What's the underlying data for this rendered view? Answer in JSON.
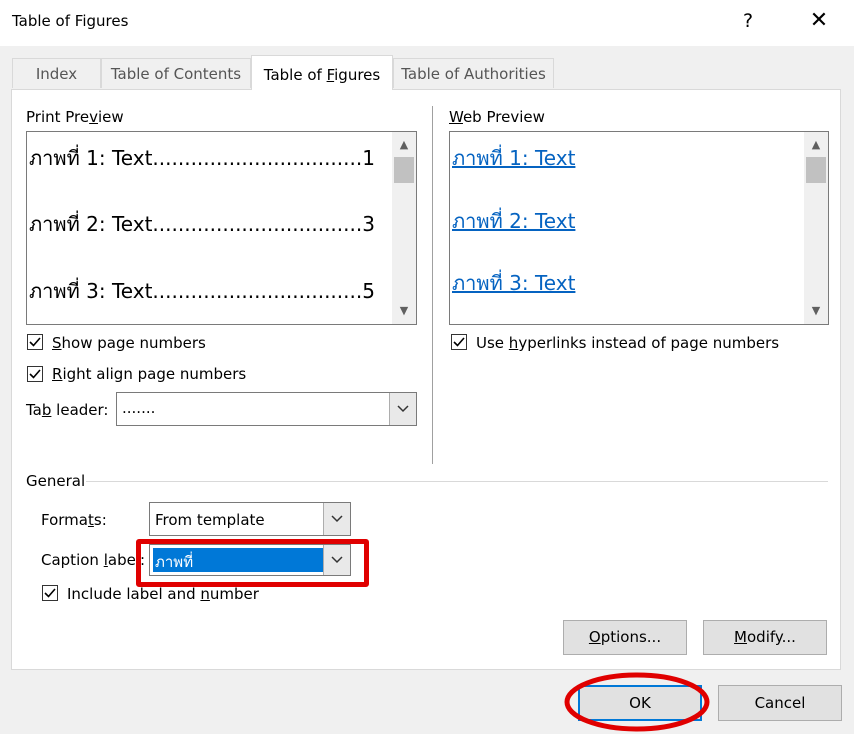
{
  "window": {
    "title": "Table of Figures",
    "help": "?",
    "close": "✕"
  },
  "tabs": [
    {
      "label": "Index"
    },
    {
      "label": "Table of Contents"
    },
    {
      "label_pre": "Table of ",
      "label_u": "F",
      "label_post": "igures"
    },
    {
      "label": "Table of Authorities"
    }
  ],
  "print_preview": {
    "heading_pre": "Print Pre",
    "heading_u": "v",
    "heading_post": "iew",
    "lines": [
      {
        "label": "ภาพที่ 1: Text",
        "page": "1"
      },
      {
        "label": "ภาพที่ 2: Text",
        "page": "3"
      },
      {
        "label": "ภาพที่ 3: Text",
        "page": "5"
      }
    ],
    "leader": ".................................",
    "show_page_numbers": {
      "pre": "",
      "u": "S",
      "post": "how page numbers",
      "checked": true
    },
    "right_align": {
      "pre": "",
      "u": "R",
      "post": "ight align page numbers",
      "checked": true
    },
    "tab_leader": {
      "pre": "Ta",
      "u": "b",
      "post": " leader:",
      "value": "......."
    }
  },
  "web_preview": {
    "heading_pre": "",
    "heading_u": "W",
    "heading_post": "eb Preview",
    "links": [
      "ภาพที่ 1: Text",
      "ภาพที่ 2: Text",
      "ภาพที่ 3: Text"
    ],
    "use_hyperlinks": {
      "pre": "Use ",
      "u": "h",
      "post": "yperlinks instead of page numbers",
      "checked": true
    }
  },
  "general": {
    "heading": "General",
    "formats": {
      "pre": "Forma",
      "u": "t",
      "post": "s:",
      "value": "From template"
    },
    "caption_label": {
      "pre": "Caption ",
      "u": "l",
      "post": "abel:",
      "value": "ภาพที่"
    },
    "include_label": {
      "pre": "Include label and ",
      "u": "n",
      "post": "umber",
      "checked": true
    }
  },
  "buttons": {
    "options": {
      "pre": "",
      "u": "O",
      "post": "ptions..."
    },
    "modify": {
      "pre": "",
      "u": "M",
      "post": "odify..."
    },
    "ok": "OK",
    "cancel": "Cancel"
  },
  "colors": {
    "highlight": "#e00000",
    "selection": "#0078d7",
    "link": "#0563c1"
  }
}
